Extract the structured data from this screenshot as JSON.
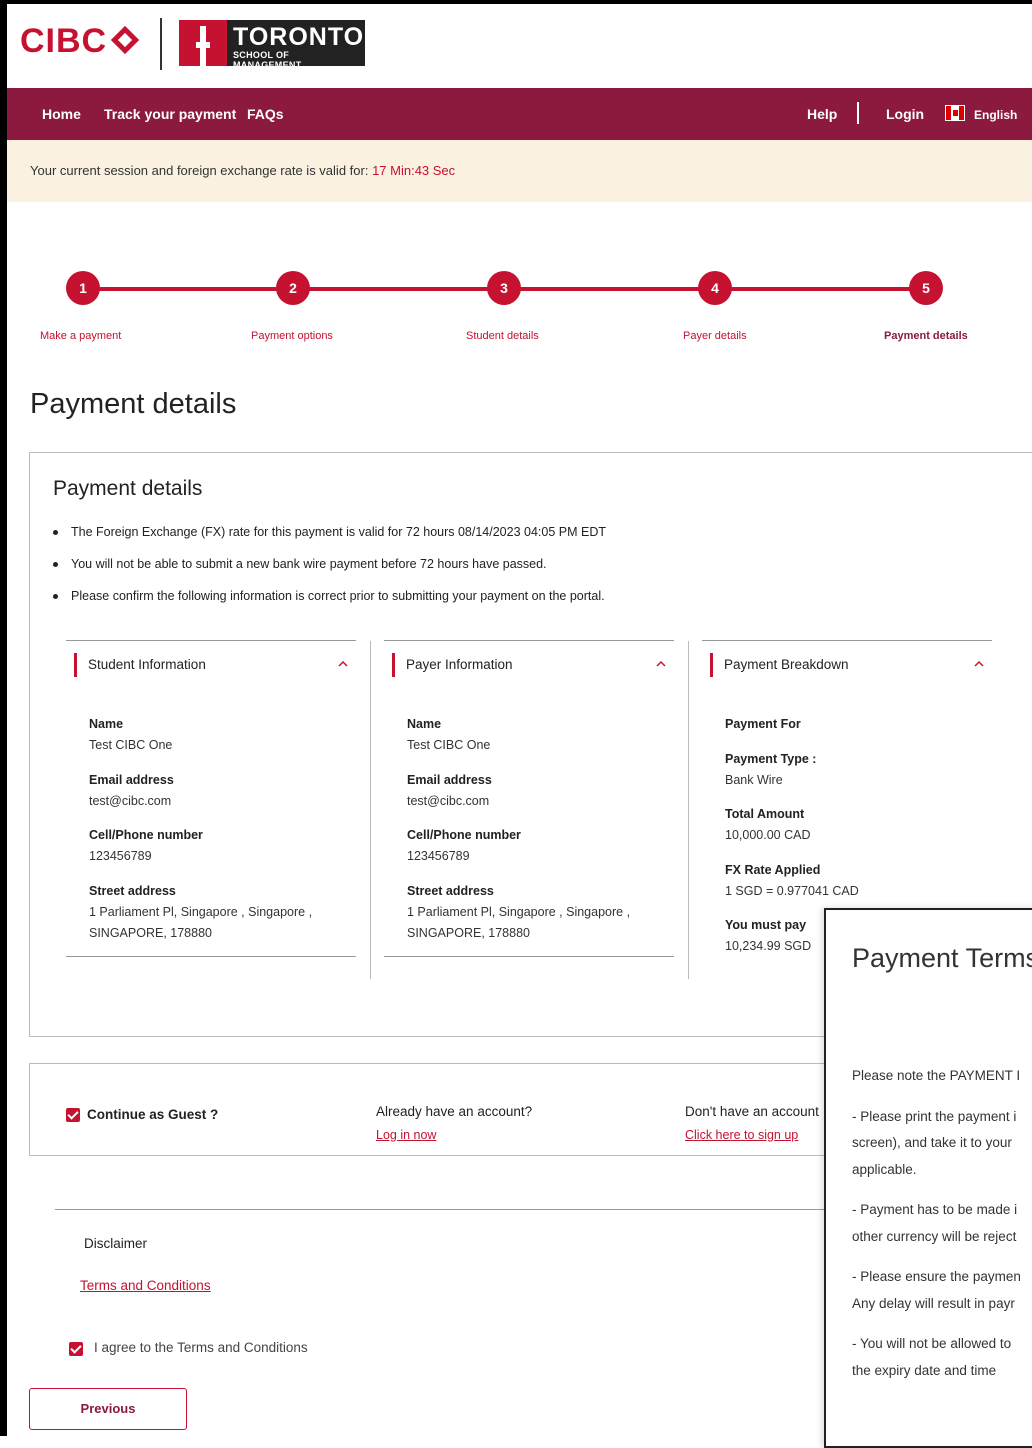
{
  "header": {
    "brand": "CIBC",
    "partner_word": "TORONTO",
    "partner_sub": "SCHOOL OF MANAGEMENT"
  },
  "nav": {
    "home": "Home",
    "track": "Track your payment",
    "faqs": "FAQs",
    "help": "Help",
    "login": "Login",
    "language": "English"
  },
  "session": {
    "text": "Your current session and foreign exchange rate is valid for: ",
    "timer": "17 Min:43 Sec"
  },
  "steps": [
    {
      "num": "1",
      "label": "Make a payment"
    },
    {
      "num": "2",
      "label": "Payment options"
    },
    {
      "num": "3",
      "label": "Student details"
    },
    {
      "num": "4",
      "label": "Payer details"
    },
    {
      "num": "5",
      "label": "Payment details"
    }
  ],
  "page_title": "Payment details",
  "card": {
    "title": "Payment details",
    "bullets": [
      "The Foreign Exchange (FX) rate for this payment is valid for 72 hours 08/14/2023 04:05 PM EDT",
      "You will not be able to submit a new bank wire payment before 72 hours have passed.",
      "Please confirm the following information is correct prior to submitting your payment on the portal."
    ]
  },
  "student": {
    "title": "Student Information",
    "name_label": "Name",
    "name": "Test CIBC One",
    "email_label": "Email address",
    "email": "test@cibc.com",
    "phone_label": "Cell/Phone number",
    "phone": "123456789",
    "address_label": "Street address",
    "address_line1": "1 Parliament Pl, Singapore , Singapore ,",
    "address_line2": "SINGAPORE, 178880"
  },
  "payer": {
    "title": "Payer Information",
    "name_label": "Name",
    "name": "Test CIBC One",
    "email_label": "Email address",
    "email": "test@cibc.com",
    "phone_label": "Cell/Phone number",
    "phone": "123456789",
    "address_label": "Street address",
    "address_line1": "1 Parliament Pl, Singapore , Singapore ,",
    "address_line2": "SINGAPORE, 178880"
  },
  "breakdown": {
    "title": "Payment Breakdown",
    "payment_for_label": "Payment For",
    "payment_type_label": "Payment Type :",
    "payment_type": "Bank Wire",
    "total_label": "Total Amount",
    "total": "10,000.00 CAD",
    "fx_label": "FX Rate Applied",
    "fx": "1 SGD = 0.977041 CAD",
    "must_pay_label": "You must pay",
    "must_pay": "10,234.99 SGD"
  },
  "guest": {
    "continue_label": "Continue as Guest ?",
    "have_account": "Already have an account?",
    "login_now": "Log in now",
    "no_account": "Don't have an account",
    "sign_up": "Click here to sign up"
  },
  "disclaimer": {
    "title": "Disclaimer",
    "terms_link": "Terms and Conditions",
    "agree_label": "I agree to the Terms and Conditions"
  },
  "buttons": {
    "previous": "Previous"
  },
  "modal": {
    "title": "Payment Terms",
    "lines": [
      "Please note the PAYMENT I",
      "- Please print the payment i",
      "screen), and take it to your",
      "applicable.",
      "- Payment has to be made i",
      "other currency will be reject",
      "- Please ensure the paymen",
      "Any delay will result in payr",
      "- You will not be allowed to",
      "the expiry date and time"
    ]
  },
  "colors": {
    "brand_red": "#c41230",
    "nav_maroon": "#8b1a3e",
    "session_bg": "#faf1e1"
  }
}
